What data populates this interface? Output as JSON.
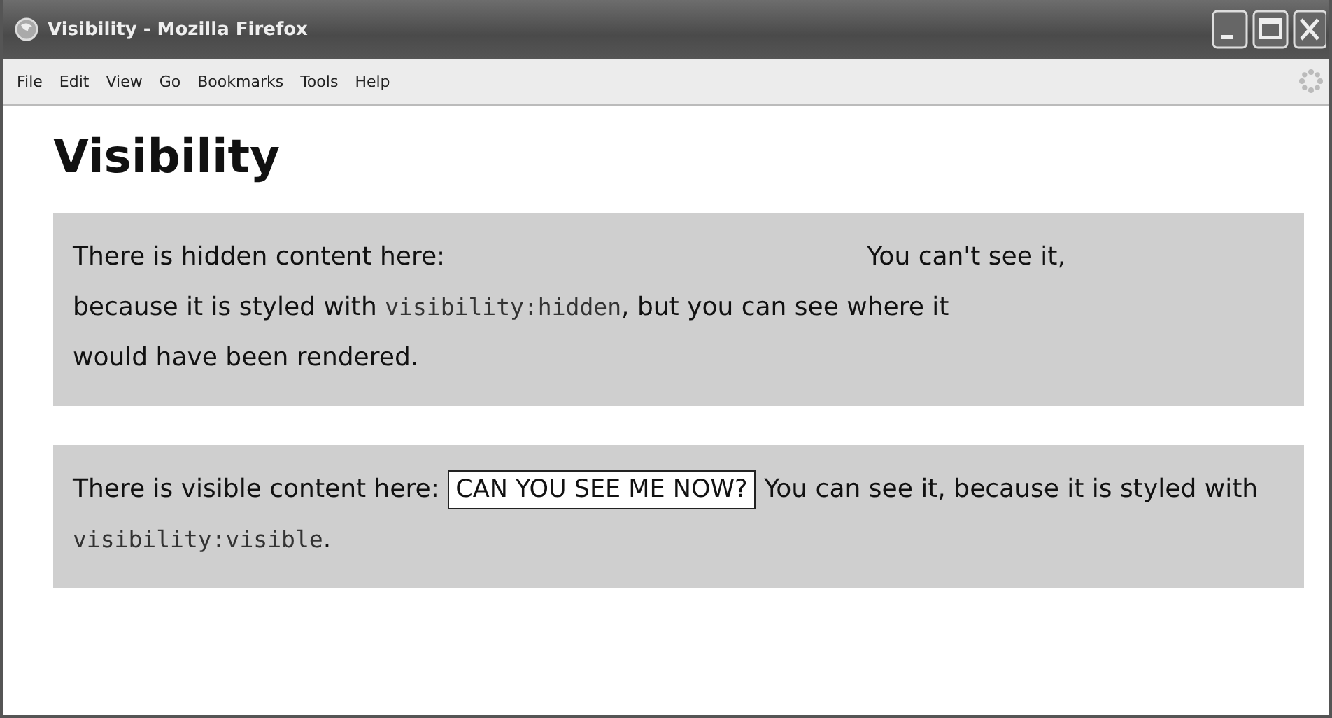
{
  "window": {
    "title": "Visibility - Mozilla Firefox"
  },
  "menu": [
    "File",
    "Edit",
    "View",
    "Go",
    "Bookmarks",
    "Tools",
    "Help"
  ],
  "heading": "Visibility",
  "boxes": [
    {
      "segments": [
        {
          "kind": "text",
          "text": "There is hidden content here:"
        },
        {
          "kind": "gap"
        },
        {
          "kind": "text",
          "text": "You can't see it,"
        },
        {
          "kind": "text",
          "text": "because it is styled with"
        },
        {
          "kind": "code",
          "text": "visibility:hidden"
        },
        {
          "kind": "text",
          "text": ", but you can see where it"
        },
        {
          "kind": "text",
          "text": "would have been rendered."
        }
      ]
    },
    {
      "segments": [
        {
          "kind": "text",
          "text": "There is visible content here:"
        },
        {
          "kind": "boxed",
          "text": "CAN YOU SEE ME NOW?"
        },
        {
          "kind": "text",
          "text": "You can see it,"
        },
        {
          "kind": "text",
          "text": "because it is styled with"
        },
        {
          "kind": "code",
          "text": "visibility:visible"
        },
        {
          "kind": "text",
          "text": "."
        }
      ]
    }
  ]
}
